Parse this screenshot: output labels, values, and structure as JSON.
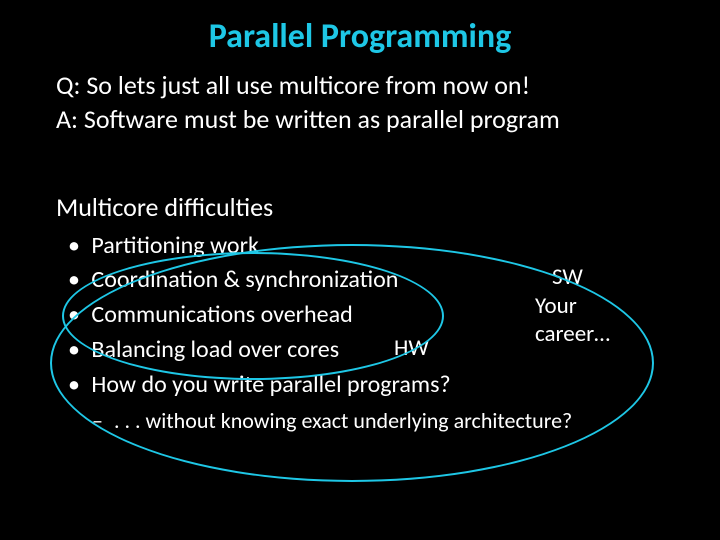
{
  "title": "Parallel Programming",
  "title_color": "#1ec7e6",
  "qa_q": "Q: So lets just all use multicore from now on!",
  "qa_a": "A: Software must be written as parallel program",
  "section": "Multicore difficulties",
  "bullets": [
    "Partitioning work",
    "Coordination & synchronization",
    "Communications overhead",
    "Balancing load over cores",
    "How do you write parallel programs?"
  ],
  "sub": ". . . without knowing exact underlying architecture?",
  "hw_label": "HW",
  "sw_label": "SW",
  "career_line1": "Your",
  "career_line2": "career…",
  "accent_color": "#1ec7e6"
}
